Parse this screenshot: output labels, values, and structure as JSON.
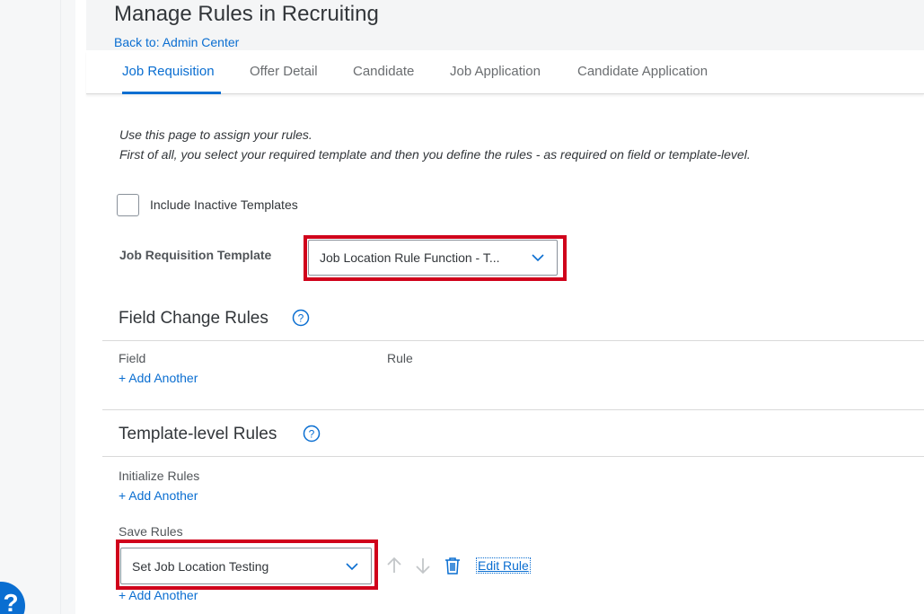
{
  "header": {
    "title": "Manage Rules in Recruiting",
    "back_link": "Back to: Admin Center"
  },
  "tabs": [
    {
      "label": "Job Requisition",
      "active": true
    },
    {
      "label": "Offer Detail",
      "active": false
    },
    {
      "label": "Candidate",
      "active": false
    },
    {
      "label": "Job Application",
      "active": false
    },
    {
      "label": "Candidate Application",
      "active": false
    }
  ],
  "intro": {
    "line1": "Use this page to assign your rules.",
    "line2": "First of all, you select your required template and then you define the rules - as required on field or template-level."
  },
  "include_inactive": {
    "label": "Include Inactive Templates",
    "checked": false
  },
  "template_select": {
    "label": "Job Requisition Template",
    "value": "Job Location Rule Function - T..."
  },
  "field_change_rules": {
    "title": "Field Change Rules",
    "col_field": "Field",
    "col_rule": "Rule",
    "add_link": "+ Add Another"
  },
  "template_level_rules": {
    "title": "Template-level Rules",
    "initialize_label": "Initialize Rules",
    "initialize_add": "+ Add Another",
    "save_label": "Save Rules",
    "save_rule_value": "Set Job Location Testing",
    "edit_rule": "Edit Rule",
    "save_add": "+ Add Another"
  },
  "help_fab": {
    "glyph": "?"
  },
  "colors": {
    "accent": "#0a6ed1",
    "highlight": "#d0021b",
    "text": "#32363a"
  }
}
